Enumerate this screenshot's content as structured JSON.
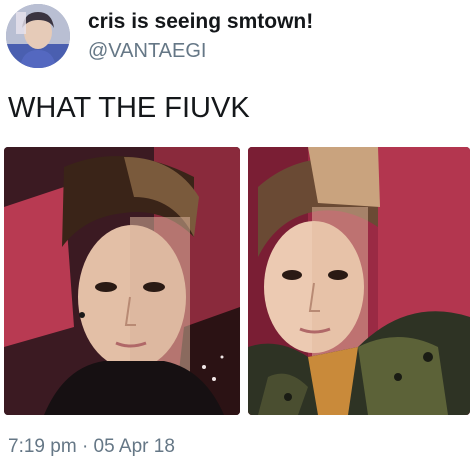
{
  "author": {
    "display_name": "cris is seeing smtown!",
    "handle": "@VANTAEGI"
  },
  "tweet": {
    "text": "WHAT THE FIUVK",
    "time": "7:19 pm",
    "separator": "·",
    "date": "05 Apr 18"
  },
  "colors": {
    "name": "#14171a",
    "secondary": "#657786",
    "background": "#ffffff"
  },
  "media": {
    "count": 2
  }
}
